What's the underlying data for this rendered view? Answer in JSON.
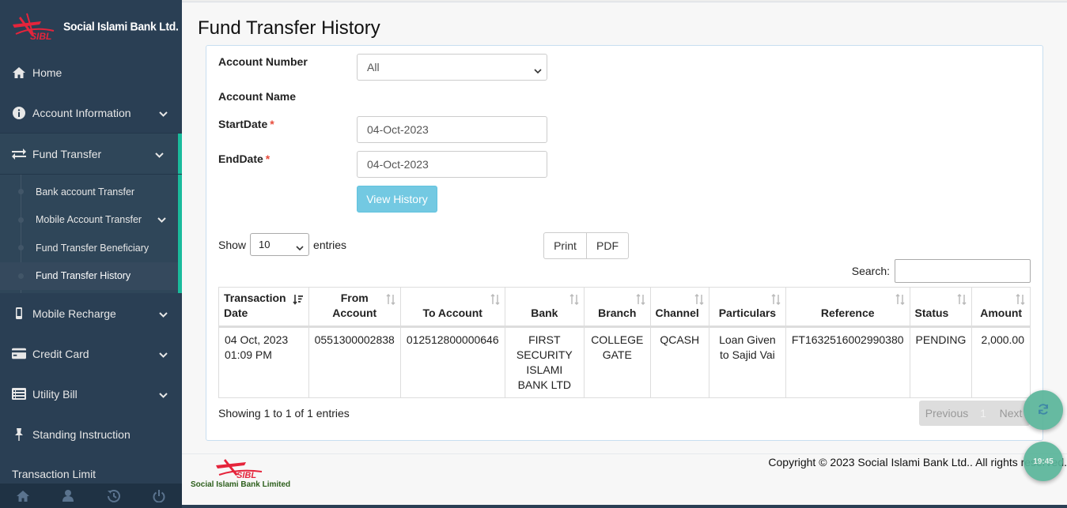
{
  "brand": {
    "name": "Social Islami Bank Ltd.",
    "logo_text": "SIBL"
  },
  "sidebar": {
    "items": [
      {
        "label": "Home",
        "icon": "home-icon"
      },
      {
        "label": "Account Information",
        "icon": "info-icon"
      },
      {
        "label": "Fund Transfer",
        "icon": "exchange-icon"
      },
      {
        "label": "Mobile Recharge",
        "icon": "mobile-icon"
      },
      {
        "label": "Credit Card",
        "icon": "credit-card-icon"
      },
      {
        "label": "Utility Bill",
        "icon": "list-icon"
      },
      {
        "label": "Standing Instruction",
        "icon": "pin-icon"
      },
      {
        "label": "Transaction Limit",
        "icon": ""
      }
    ],
    "fund_transfer_sub": [
      {
        "label": "Bank account Transfer"
      },
      {
        "label": "Mobile Account Transfer"
      },
      {
        "label": "Fund Transfer Beneficiary"
      },
      {
        "label": "Fund Transfer History"
      }
    ],
    "footer_icons": [
      "home-icon",
      "user-icon",
      "history-icon",
      "power-icon"
    ]
  },
  "page": {
    "title": "Fund Transfer History"
  },
  "form": {
    "account_number_label": "Account Number",
    "account_number_value": "All",
    "account_name_label": "Account Name",
    "start_date_label": "StartDate",
    "start_date_value": "04-Oct-2023",
    "end_date_label": "EndDate",
    "end_date_value": "04-Oct-2023",
    "required_mark": "*",
    "view_button": "View History"
  },
  "table_controls": {
    "show_label": "Show",
    "entries_label": "entries",
    "page_length": "10",
    "print_label": "Print",
    "pdf_label": "PDF",
    "search_label": "Search:"
  },
  "table": {
    "headers": [
      "Transaction Date",
      "From Account",
      "To Account",
      "Bank",
      "Branch",
      "Channel",
      "Particulars",
      "Reference",
      "Status",
      "Amount"
    ],
    "rows": [
      {
        "date": "04 Oct, 2023 01:09 PM",
        "from": "0551300002838",
        "to": "012512800000646",
        "bank": "FIRST SECURITY ISLAMI BANK LTD",
        "branch": "COLLEGE GATE",
        "channel": "QCASH",
        "particulars": "Loan Given to Sajid Vai",
        "reference": "FT1632516002990380",
        "status": "PENDING",
        "amount": "2,000.00"
      }
    ]
  },
  "pagination": {
    "info": "Showing 1 to 1 of 1 entries",
    "previous": "Previous",
    "current": "1",
    "next": "Next"
  },
  "footer": {
    "logo_text": "SIBL",
    "bank_name": "Social Islami Bank Limited",
    "copyright": "Copyright © 2023 Social Islami Bank Ltd.. All rights reserved."
  },
  "floating": {
    "clock_text": "19:45"
  },
  "colors": {
    "sidebar_bg": "#2a3f54",
    "accent": "#1abb9c",
    "info_button": "#5bc0de",
    "brand_red": "#e5243b",
    "fab": "#5ab59a"
  }
}
